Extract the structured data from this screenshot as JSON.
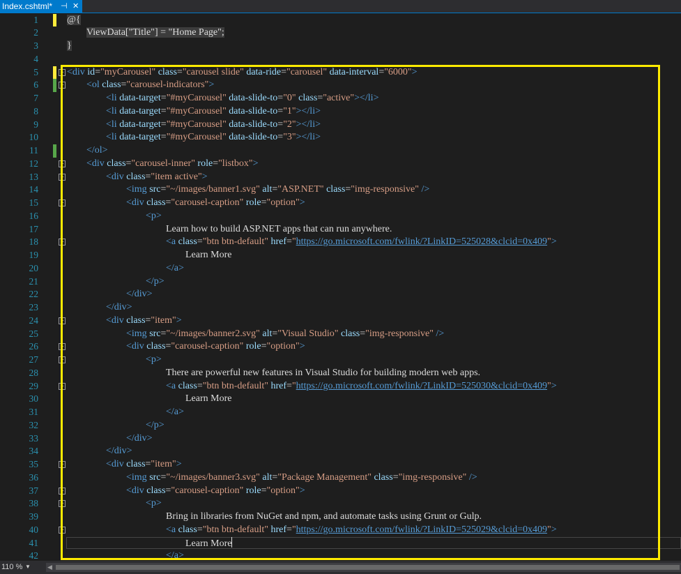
{
  "tab": {
    "name": "Index.cshtml*",
    "pin_icon": "⊣",
    "close_icon": "✕"
  },
  "status": {
    "zoom": "110 %",
    "dropdown_icon": "▼",
    "scroll_left_icon": "◀"
  },
  "colors": {
    "tag": "#569cd6",
    "attr": "#9cdcfe",
    "string": "#d69d85",
    "text": "#dcdcdc",
    "line_number": "#2b91af",
    "highlight": "#ffeb00",
    "accent": "#007acc"
  },
  "lines": [
    {
      "n": "1",
      "tokens": [
        {
          "c": "razor",
          "v": "@{"
        }
      ]
    },
    {
      "n": "2",
      "tokens": [
        {
          "c": "razor",
          "v": "ViewData[\"Title\"] = \"Home Page\";"
        }
      ]
    },
    {
      "n": "3",
      "tokens": [
        {
          "c": "razor",
          "v": "}"
        }
      ]
    },
    {
      "n": "4",
      "tokens": []
    },
    {
      "n": "5",
      "tokens": [
        {
          "c": "tag",
          "v": "<div "
        },
        {
          "c": "attr",
          "v": "id"
        },
        {
          "c": "txt",
          "v": "="
        },
        {
          "c": "str",
          "v": "\"myCarousel\""
        },
        {
          "c": "txt",
          "v": " "
        },
        {
          "c": "attr",
          "v": "class"
        },
        {
          "c": "txt",
          "v": "="
        },
        {
          "c": "str",
          "v": "\"carousel slide\""
        },
        {
          "c": "txt",
          "v": " "
        },
        {
          "c": "attr",
          "v": "data-ride"
        },
        {
          "c": "txt",
          "v": "="
        },
        {
          "c": "str",
          "v": "\"carousel\""
        },
        {
          "c": "txt",
          "v": " "
        },
        {
          "c": "attr",
          "v": "data-interval"
        },
        {
          "c": "txt",
          "v": "="
        },
        {
          "c": "str",
          "v": "\"6000\""
        },
        {
          "c": "tag",
          "v": ">"
        }
      ]
    },
    {
      "n": "6",
      "tokens": [
        {
          "c": "tag",
          "v": "<ol "
        },
        {
          "c": "attr",
          "v": "class"
        },
        {
          "c": "txt",
          "v": "="
        },
        {
          "c": "str",
          "v": "\"carousel-indicators\""
        },
        {
          "c": "tag",
          "v": ">"
        }
      ]
    },
    {
      "n": "7",
      "tokens": [
        {
          "c": "tag",
          "v": "<li "
        },
        {
          "c": "attr",
          "v": "data-target"
        },
        {
          "c": "txt",
          "v": "="
        },
        {
          "c": "str",
          "v": "\"#myCarousel\""
        },
        {
          "c": "txt",
          "v": " "
        },
        {
          "c": "attr",
          "v": "data-slide-to"
        },
        {
          "c": "txt",
          "v": "="
        },
        {
          "c": "str",
          "v": "\"0\""
        },
        {
          "c": "txt",
          "v": " "
        },
        {
          "c": "attr",
          "v": "class"
        },
        {
          "c": "txt",
          "v": "="
        },
        {
          "c": "str",
          "v": "\"active\""
        },
        {
          "c": "tag",
          "v": "></li>"
        }
      ]
    },
    {
      "n": "8",
      "tokens": [
        {
          "c": "tag",
          "v": "<li "
        },
        {
          "c": "attr",
          "v": "data-target"
        },
        {
          "c": "txt",
          "v": "="
        },
        {
          "c": "str",
          "v": "\"#myCarousel\""
        },
        {
          "c": "txt",
          "v": " "
        },
        {
          "c": "attr",
          "v": "data-slide-to"
        },
        {
          "c": "txt",
          "v": "="
        },
        {
          "c": "str",
          "v": "\"1\""
        },
        {
          "c": "tag",
          "v": "></li>"
        }
      ]
    },
    {
      "n": "9",
      "tokens": [
        {
          "c": "tag",
          "v": "<li "
        },
        {
          "c": "attr",
          "v": "data-target"
        },
        {
          "c": "txt",
          "v": "="
        },
        {
          "c": "str",
          "v": "\"#myCarousel\""
        },
        {
          "c": "txt",
          "v": " "
        },
        {
          "c": "attr",
          "v": "data-slide-to"
        },
        {
          "c": "txt",
          "v": "="
        },
        {
          "c": "str",
          "v": "\"2\""
        },
        {
          "c": "tag",
          "v": "></li>"
        }
      ]
    },
    {
      "n": "10",
      "tokens": [
        {
          "c": "tag",
          "v": "<li "
        },
        {
          "c": "attr",
          "v": "data-target"
        },
        {
          "c": "txt",
          "v": "="
        },
        {
          "c": "str",
          "v": "\"#myCarousel\""
        },
        {
          "c": "txt",
          "v": " "
        },
        {
          "c": "attr",
          "v": "data-slide-to"
        },
        {
          "c": "txt",
          "v": "="
        },
        {
          "c": "str",
          "v": "\"3\""
        },
        {
          "c": "tag",
          "v": "></li>"
        }
      ]
    },
    {
      "n": "11",
      "tokens": [
        {
          "c": "tag",
          "v": "</ol>"
        }
      ]
    },
    {
      "n": "12",
      "tokens": [
        {
          "c": "tag",
          "v": "<div "
        },
        {
          "c": "attr",
          "v": "class"
        },
        {
          "c": "txt",
          "v": "="
        },
        {
          "c": "str",
          "v": "\"carousel-inner\""
        },
        {
          "c": "txt",
          "v": " "
        },
        {
          "c": "attr",
          "v": "role"
        },
        {
          "c": "txt",
          "v": "="
        },
        {
          "c": "str",
          "v": "\"listbox\""
        },
        {
          "c": "tag",
          "v": ">"
        }
      ]
    },
    {
      "n": "13",
      "tokens": [
        {
          "c": "tag",
          "v": "<div "
        },
        {
          "c": "attr",
          "v": "class"
        },
        {
          "c": "txt",
          "v": "="
        },
        {
          "c": "str",
          "v": "\"item active\""
        },
        {
          "c": "tag",
          "v": ">"
        }
      ]
    },
    {
      "n": "14",
      "tokens": [
        {
          "c": "tag",
          "v": "<img "
        },
        {
          "c": "attr",
          "v": "src"
        },
        {
          "c": "txt",
          "v": "="
        },
        {
          "c": "str",
          "v": "\"~/images/banner1.svg\""
        },
        {
          "c": "txt",
          "v": " "
        },
        {
          "c": "attr",
          "v": "alt"
        },
        {
          "c": "txt",
          "v": "="
        },
        {
          "c": "str",
          "v": "\"ASP.NET\""
        },
        {
          "c": "txt",
          "v": " "
        },
        {
          "c": "attr",
          "v": "class"
        },
        {
          "c": "txt",
          "v": "="
        },
        {
          "c": "str",
          "v": "\"img-responsive\""
        },
        {
          "c": "txt",
          "v": " "
        },
        {
          "c": "tag",
          "v": "/>"
        }
      ]
    },
    {
      "n": "15",
      "tokens": [
        {
          "c": "tag",
          "v": "<div "
        },
        {
          "c": "attr",
          "v": "class"
        },
        {
          "c": "txt",
          "v": "="
        },
        {
          "c": "str",
          "v": "\"carousel-caption\""
        },
        {
          "c": "txt",
          "v": " "
        },
        {
          "c": "attr",
          "v": "role"
        },
        {
          "c": "txt",
          "v": "="
        },
        {
          "c": "str",
          "v": "\"option\""
        },
        {
          "c": "tag",
          "v": ">"
        }
      ]
    },
    {
      "n": "16",
      "tokens": [
        {
          "c": "tag",
          "v": "<p>"
        }
      ]
    },
    {
      "n": "17",
      "tokens": [
        {
          "c": "txt",
          "v": "Learn how to build ASP.NET apps that can run anywhere."
        }
      ]
    },
    {
      "n": "18",
      "tokens": [
        {
          "c": "tag",
          "v": "<a "
        },
        {
          "c": "attr",
          "v": "class"
        },
        {
          "c": "txt",
          "v": "="
        },
        {
          "c": "str",
          "v": "\"btn btn-default\""
        },
        {
          "c": "txt",
          "v": " "
        },
        {
          "c": "attr",
          "v": "href"
        },
        {
          "c": "txt",
          "v": "="
        },
        {
          "c": "str",
          "v": "\""
        },
        {
          "c": "link",
          "v": "https://go.microsoft.com/fwlink/?LinkID=525028&clcid=0x409"
        },
        {
          "c": "str",
          "v": "\""
        },
        {
          "c": "tag",
          "v": ">"
        }
      ]
    },
    {
      "n": "19",
      "tokens": [
        {
          "c": "txt",
          "v": "Learn More"
        }
      ]
    },
    {
      "n": "20",
      "tokens": [
        {
          "c": "tag",
          "v": "</a>"
        }
      ]
    },
    {
      "n": "21",
      "tokens": [
        {
          "c": "tag",
          "v": "</p>"
        }
      ]
    },
    {
      "n": "22",
      "tokens": [
        {
          "c": "tag",
          "v": "</div>"
        }
      ]
    },
    {
      "n": "23",
      "tokens": [
        {
          "c": "tag",
          "v": "</div>"
        }
      ]
    },
    {
      "n": "24",
      "tokens": [
        {
          "c": "tag",
          "v": "<div "
        },
        {
          "c": "attr",
          "v": "class"
        },
        {
          "c": "txt",
          "v": "="
        },
        {
          "c": "str",
          "v": "\"item\""
        },
        {
          "c": "tag",
          "v": ">"
        }
      ]
    },
    {
      "n": "25",
      "tokens": [
        {
          "c": "tag",
          "v": "<img "
        },
        {
          "c": "attr",
          "v": "src"
        },
        {
          "c": "txt",
          "v": "="
        },
        {
          "c": "str",
          "v": "\"~/images/banner2.svg\""
        },
        {
          "c": "txt",
          "v": " "
        },
        {
          "c": "attr",
          "v": "alt"
        },
        {
          "c": "txt",
          "v": "="
        },
        {
          "c": "str",
          "v": "\"Visual Studio\""
        },
        {
          "c": "txt",
          "v": " "
        },
        {
          "c": "attr",
          "v": "class"
        },
        {
          "c": "txt",
          "v": "="
        },
        {
          "c": "str",
          "v": "\"img-responsive\""
        },
        {
          "c": "txt",
          "v": " "
        },
        {
          "c": "tag",
          "v": "/>"
        }
      ]
    },
    {
      "n": "26",
      "tokens": [
        {
          "c": "tag",
          "v": "<div "
        },
        {
          "c": "attr",
          "v": "class"
        },
        {
          "c": "txt",
          "v": "="
        },
        {
          "c": "str",
          "v": "\"carousel-caption\""
        },
        {
          "c": "txt",
          "v": " "
        },
        {
          "c": "attr",
          "v": "role"
        },
        {
          "c": "txt",
          "v": "="
        },
        {
          "c": "str",
          "v": "\"option\""
        },
        {
          "c": "tag",
          "v": ">"
        }
      ]
    },
    {
      "n": "27",
      "tokens": [
        {
          "c": "tag",
          "v": "<p>"
        }
      ]
    },
    {
      "n": "28",
      "tokens": [
        {
          "c": "txt",
          "v": "There are powerful new features in Visual Studio for building modern web apps."
        }
      ]
    },
    {
      "n": "29",
      "tokens": [
        {
          "c": "tag",
          "v": "<a "
        },
        {
          "c": "attr",
          "v": "class"
        },
        {
          "c": "txt",
          "v": "="
        },
        {
          "c": "str",
          "v": "\"btn btn-default\""
        },
        {
          "c": "txt",
          "v": " "
        },
        {
          "c": "attr",
          "v": "href"
        },
        {
          "c": "txt",
          "v": "="
        },
        {
          "c": "str",
          "v": "\""
        },
        {
          "c": "link",
          "v": "https://go.microsoft.com/fwlink/?LinkID=525030&clcid=0x409"
        },
        {
          "c": "str",
          "v": "\""
        },
        {
          "c": "tag",
          "v": ">"
        }
      ]
    },
    {
      "n": "30",
      "tokens": [
        {
          "c": "txt",
          "v": "Learn More"
        }
      ]
    },
    {
      "n": "31",
      "tokens": [
        {
          "c": "tag",
          "v": "</a>"
        }
      ]
    },
    {
      "n": "32",
      "tokens": [
        {
          "c": "tag",
          "v": "</p>"
        }
      ]
    },
    {
      "n": "33",
      "tokens": [
        {
          "c": "tag",
          "v": "</div>"
        }
      ]
    },
    {
      "n": "34",
      "tokens": [
        {
          "c": "tag",
          "v": "</div>"
        }
      ]
    },
    {
      "n": "35",
      "tokens": [
        {
          "c": "tag",
          "v": "<div "
        },
        {
          "c": "attr",
          "v": "class"
        },
        {
          "c": "txt",
          "v": "="
        },
        {
          "c": "str",
          "v": "\"item\""
        },
        {
          "c": "tag",
          "v": ">"
        }
      ]
    },
    {
      "n": "36",
      "tokens": [
        {
          "c": "tag",
          "v": "<img "
        },
        {
          "c": "attr",
          "v": "src"
        },
        {
          "c": "txt",
          "v": "="
        },
        {
          "c": "str",
          "v": "\"~/images/banner3.svg\""
        },
        {
          "c": "txt",
          "v": " "
        },
        {
          "c": "attr",
          "v": "alt"
        },
        {
          "c": "txt",
          "v": "="
        },
        {
          "c": "str",
          "v": "\"Package Management\""
        },
        {
          "c": "txt",
          "v": " "
        },
        {
          "c": "attr",
          "v": "class"
        },
        {
          "c": "txt",
          "v": "="
        },
        {
          "c": "str",
          "v": "\"img-responsive\""
        },
        {
          "c": "txt",
          "v": " "
        },
        {
          "c": "tag",
          "v": "/>"
        }
      ]
    },
    {
      "n": "37",
      "tokens": [
        {
          "c": "tag",
          "v": "<div "
        },
        {
          "c": "attr",
          "v": "class"
        },
        {
          "c": "txt",
          "v": "="
        },
        {
          "c": "str",
          "v": "\"carousel-caption\""
        },
        {
          "c": "txt",
          "v": " "
        },
        {
          "c": "attr",
          "v": "role"
        },
        {
          "c": "txt",
          "v": "="
        },
        {
          "c": "str",
          "v": "\"option\""
        },
        {
          "c": "tag",
          "v": ">"
        }
      ]
    },
    {
      "n": "38",
      "tokens": [
        {
          "c": "tag",
          "v": "<p>"
        }
      ]
    },
    {
      "n": "39",
      "tokens": [
        {
          "c": "txt",
          "v": "Bring in libraries from NuGet and npm, and automate tasks using Grunt or Gulp."
        }
      ]
    },
    {
      "n": "40",
      "tokens": [
        {
          "c": "tag",
          "v": "<a "
        },
        {
          "c": "attr",
          "v": "class"
        },
        {
          "c": "txt",
          "v": "="
        },
        {
          "c": "str",
          "v": "\"btn btn-default\""
        },
        {
          "c": "txt",
          "v": " "
        },
        {
          "c": "attr",
          "v": "href"
        },
        {
          "c": "txt",
          "v": "="
        },
        {
          "c": "str",
          "v": "\""
        },
        {
          "c": "link",
          "v": "https://go.microsoft.com/fwlink/?LinkID=525029&clcid=0x409"
        },
        {
          "c": "str",
          "v": "\""
        },
        {
          "c": "tag",
          "v": ">"
        }
      ]
    },
    {
      "n": "41",
      "tokens": [
        {
          "c": "txt",
          "v": "Learn More"
        }
      ]
    },
    {
      "n": "42",
      "tokens": [
        {
          "c": "tag",
          "v": "</a>"
        }
      ]
    }
  ]
}
